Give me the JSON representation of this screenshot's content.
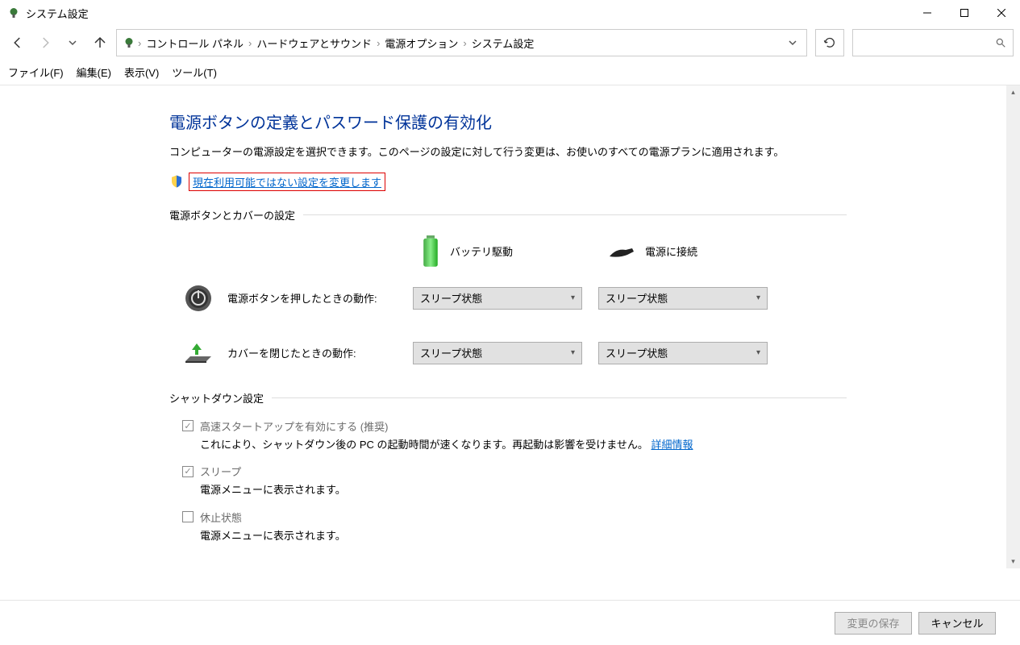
{
  "window": {
    "title": "システム設定"
  },
  "breadcrumb": {
    "items": [
      "コントロール パネル",
      "ハードウェアとサウンド",
      "電源オプション",
      "システム設定"
    ]
  },
  "menubar": {
    "file": "ファイル(F)",
    "edit": "編集(E)",
    "view": "表示(V)",
    "tools": "ツール(T)"
  },
  "page": {
    "title": "電源ボタンの定義とパスワード保護の有効化",
    "description": "コンピューターの電源設定を選択できます。このページの設定に対して行う変更は、お使いのすべての電源プランに適用されます。",
    "admin_link": "現在利用可能ではない設定を変更します"
  },
  "section1": {
    "header": "電源ボタンとカバーの設定",
    "col_battery": "バッテリ駆動",
    "col_plugged": "電源に接続",
    "rows": [
      {
        "label": "電源ボタンを押したときの動作:",
        "battery": "スリープ状態",
        "plugged": "スリープ状態"
      },
      {
        "label": "カバーを閉じたときの動作:",
        "battery": "スリープ状態",
        "plugged": "スリープ状態"
      }
    ]
  },
  "section2": {
    "header": "シャットダウン設定",
    "items": [
      {
        "checked": true,
        "label": "高速スタートアップを有効にする (推奨)",
        "desc_pre": "これにより、シャットダウン後の PC の起動時間が速くなります。再起動は影響を受けません。",
        "link": "詳細情報"
      },
      {
        "checked": true,
        "label": "スリープ",
        "desc_pre": "電源メニューに表示されます。",
        "link": ""
      },
      {
        "checked": false,
        "label": "休止状態",
        "desc_pre": "電源メニューに表示されます。",
        "link": ""
      }
    ]
  },
  "footer": {
    "save": "変更の保存",
    "cancel": "キャンセル"
  }
}
